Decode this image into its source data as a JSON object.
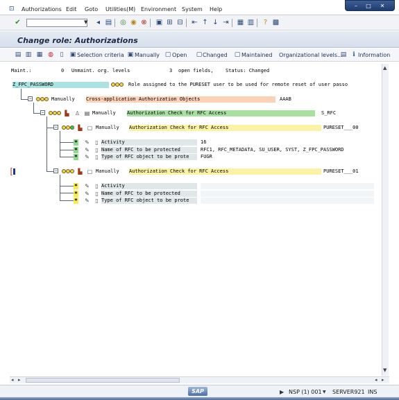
{
  "menubar": {
    "items": [
      "Authorizations",
      "Edit",
      "Goto",
      "Utilities(M)",
      "Environment",
      "System",
      "Help"
    ]
  },
  "title": "Change role: Authorizations",
  "app_toolbar": {
    "selection_criteria": "Selection criteria",
    "manually": "Manually",
    "open": "Open",
    "changed": "Changed",
    "maintained": "Maintained",
    "org_levels": "Organizational levels...",
    "information": "Information"
  },
  "status_line": {
    "maint_label": "Maint.:",
    "unmaint_count": "0",
    "unmaint_label": "Unmaint. org. levels",
    "open_count": "3",
    "open_label": "open fields,",
    "status_label": "Status: Changed"
  },
  "tree": {
    "root": {
      "name": "Z_FPC_PASSWORD",
      "description": "Role assigned to the PURESET user to be used for remote reset of user passo"
    },
    "class": {
      "source": "Manually",
      "text": "Cross-application Authorization Objects",
      "code": "AAAB"
    },
    "object": {
      "source": "Manually",
      "text": "Authorization Check for RFC Access",
      "code": "S_RFC"
    },
    "auth1": {
      "source": "Manually",
      "text": "Authorization Check for RFC Access",
      "code": "PURESET___00",
      "fields": [
        {
          "label": "Activity",
          "value": "16"
        },
        {
          "label": "Name of RFC to be protected",
          "value": "RFC1, RFC_METADATA, SU_USER, SYST, Z_FPC_PASSWORD"
        },
        {
          "label": "Type of RFC object to be prote",
          "value": "FUGR"
        }
      ]
    },
    "auth2": {
      "source": "Manually",
      "text": "Authorization Check for RFC Access",
      "code": "PURESET___01",
      "fields": [
        {
          "label": "Activity",
          "value": ""
        },
        {
          "label": "Name of RFC to be protected",
          "value": ""
        },
        {
          "label": "Type of RFC object to be prote",
          "value": ""
        }
      ]
    }
  },
  "statusbar": {
    "system": "NSP (1) 001",
    "server": "SERVER921",
    "mode": "INS",
    "logo": "SAP"
  },
  "colors": {
    "green": "#a8e0a2",
    "salmon": "#fbd2b5",
    "yellow": "#fbf2a4",
    "cyan": "#a9e3e3"
  }
}
